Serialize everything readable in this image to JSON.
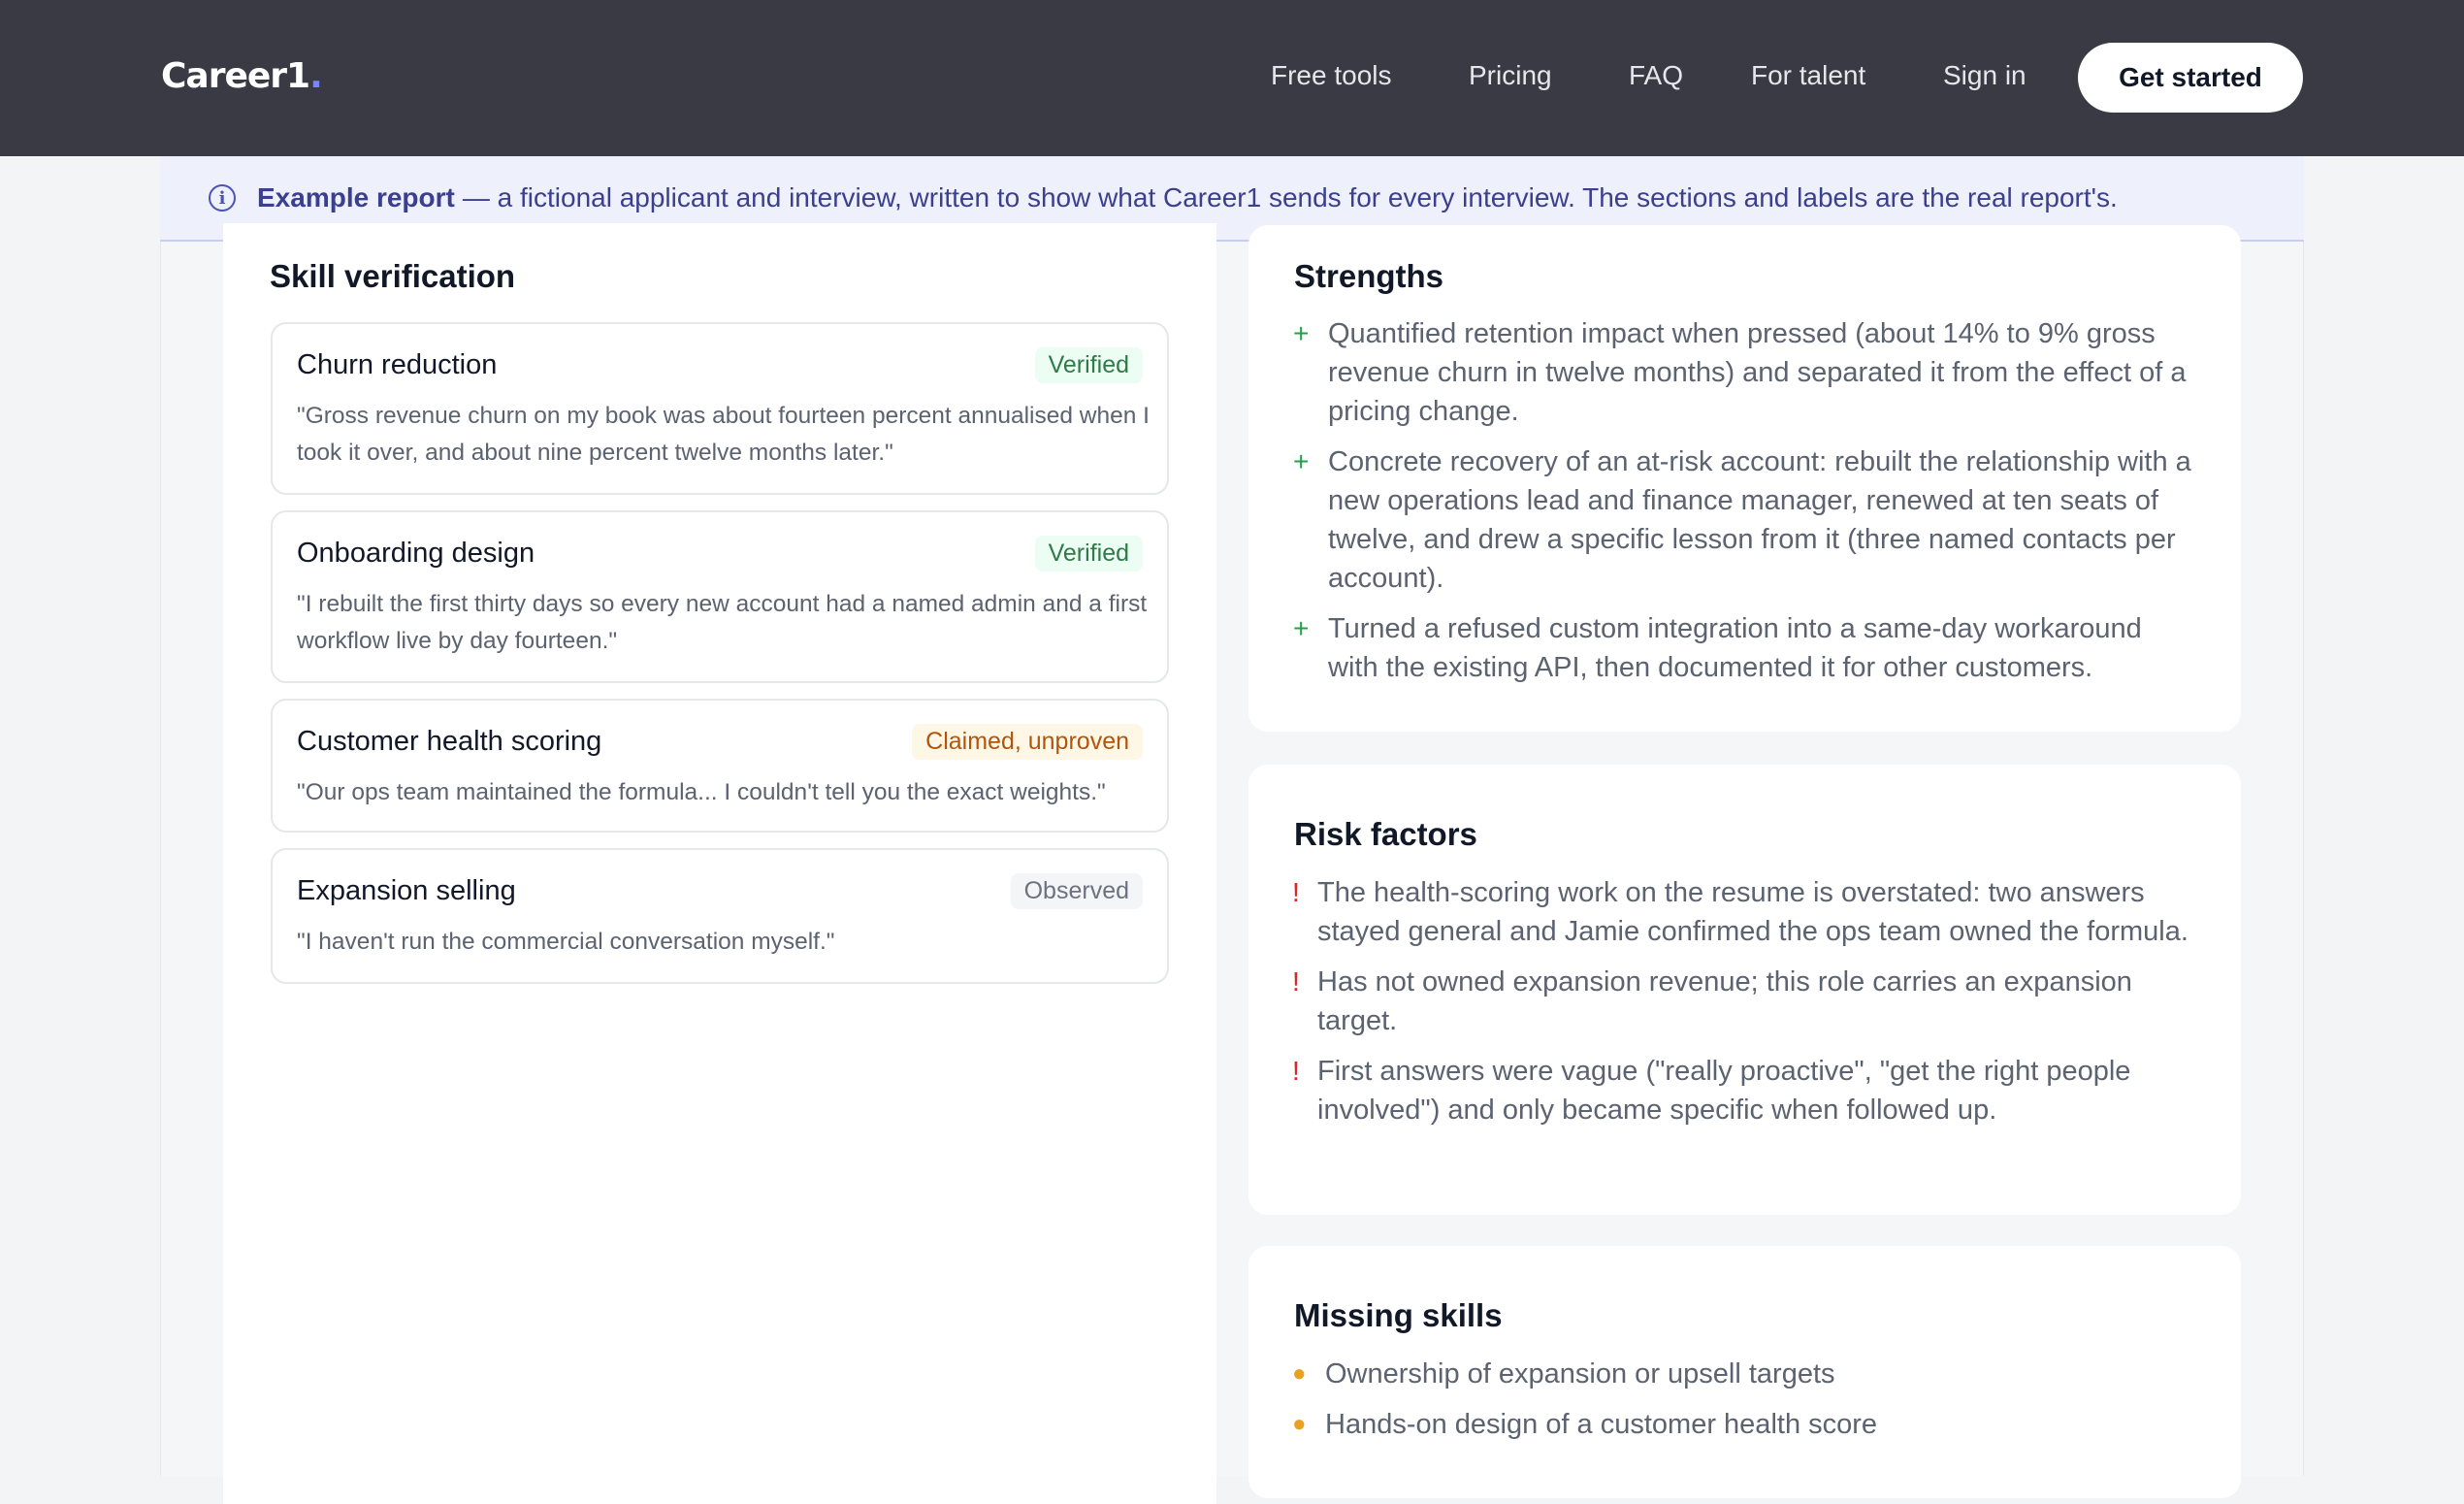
{
  "header": {
    "logo": "Career1",
    "logo_dot": ".",
    "nav": [
      "Free tools",
      "Pricing",
      "FAQ",
      "For talent",
      "Sign in"
    ],
    "cta": "Get started"
  },
  "banner": {
    "icon": "info-icon",
    "bold": "Example report",
    "text": "— a fictional applicant and interview, written to show what Career1 sends for every interview. The sections and labels are the real report's."
  },
  "skill_verification": {
    "title": "Skill verification",
    "skills": [
      {
        "name": "Churn reduction",
        "status": "Verified",
        "quote": "\"Gross revenue churn on my book was about fourteen percent annualised when I took it over, and about nine percent twelve months later.\""
      },
      {
        "name": "Onboarding design",
        "status": "Verified",
        "quote": "\"I rebuilt the first thirty days so every new account had a named admin and a first workflow live by day fourteen.\""
      },
      {
        "name": "Customer health scoring",
        "status": "Claimed, unproven",
        "quote": "\"Our ops team maintained the formula... I couldn't tell you the exact weights.\""
      },
      {
        "name": "Expansion selling",
        "status": "Observed",
        "quote": "\"I haven't run the commercial conversation myself.\""
      }
    ]
  },
  "strengths": {
    "title": "Strengths",
    "items": [
      "Quantified retention impact when pressed (about 14% to 9% gross revenue churn in twelve months) and separated it from the effect of a pricing change.",
      "Concrete recovery of an at-risk account: rebuilt the relationship with a new operations lead and finance manager, renewed at ten seats of twelve, and drew a specific lesson from it (three named contacts per account).",
      "Turned a refused custom integration into a same-day workaround with the existing API, then documented it for other customers."
    ]
  },
  "risk_factors": {
    "title": "Risk factors",
    "items": [
      "The health-scoring work on the resume is overstated: two answers stayed general and Jamie confirmed the ops team owned the formula.",
      "Has not owned expansion revenue; this role carries an expansion target.",
      "First answers were vague (\"really proactive\", \"get the right people involved\") and only became specific when followed up."
    ]
  },
  "missing_skills": {
    "title": "Missing skills",
    "items": [
      "Ownership of expansion or upsell targets",
      "Hands-on design of a customer health score"
    ]
  },
  "colors": {
    "topbar": "#393a44",
    "banner_bg": "#eef0fb",
    "verified": "#2f7a48",
    "claimed": "#b4540a",
    "plus": "#22a04b",
    "risk": "#dc2626",
    "missing": "#eaa020"
  }
}
